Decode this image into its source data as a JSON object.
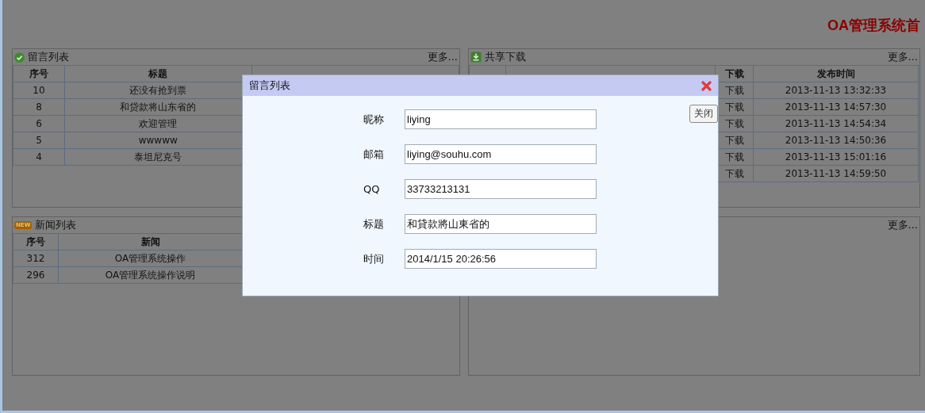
{
  "page_title": "OA管理系统首",
  "panels": [
    {
      "title": "留言列表",
      "more": "更多...",
      "columns": [
        "序号",
        "标题",
        ""
      ],
      "rows": [
        [
          "10",
          "还没有抢到票"
        ],
        [
          "8",
          "和贷款将山东省的"
        ],
        [
          "6",
          "欢迎管理"
        ],
        [
          "5",
          "wwwww"
        ],
        [
          "4",
          "泰坦尼克号"
        ]
      ]
    },
    {
      "title": "共享下载",
      "more": "更多...",
      "columns": [
        "",
        "",
        "下载",
        "发布时间"
      ],
      "rows": [
        [
          "",
          "",
          "下载",
          "2013-11-13 13:32:33"
        ],
        [
          "",
          "",
          "下载",
          "2013-11-13 14:57:30"
        ],
        [
          "",
          "",
          "下载",
          "2013-11-13 14:54:34"
        ],
        [
          "",
          "",
          "下载",
          "2013-11-13 14:50:36"
        ],
        [
          "",
          "",
          "下载",
          "2013-11-13 15:01:16"
        ],
        [
          "",
          "",
          "下载",
          "2013-11-13 14:59:50"
        ]
      ]
    },
    {
      "badge": "NEW",
      "title": "新闻列表",
      "columns": [
        "序号",
        "新闻"
      ],
      "rows": [
        [
          "312",
          "OA管理系统操作"
        ],
        [
          "296",
          "OA管理系统操作说明"
        ]
      ]
    },
    {
      "more": "更多..."
    }
  ],
  "dialog": {
    "title": "留言列表",
    "close_tooltip": "关闭",
    "fields": [
      {
        "label": "昵称",
        "value": "liying"
      },
      {
        "label": "邮箱",
        "value": "liying@souhu.com"
      },
      {
        "label": "QQ",
        "value": "33733213131"
      },
      {
        "label": "标题",
        "value": "和貸款將山東省的"
      },
      {
        "label": "时间",
        "value": "2014/1/15 20:26:56"
      }
    ]
  }
}
